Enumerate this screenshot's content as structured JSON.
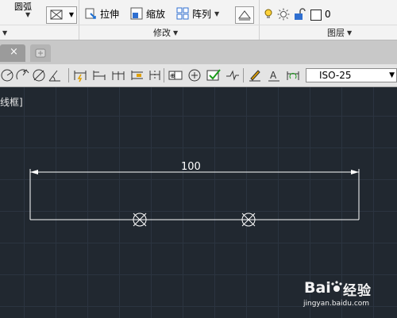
{
  "ribbon": {
    "arc_label": "圆弧",
    "stretch_label": "拉伸",
    "scale_label": "缩放",
    "array_label": "阵列",
    "modify_panel": "修改",
    "layers_panel": "图层",
    "layer_value": "0"
  },
  "dim_toolbar": {
    "dim_style": "ISO-25"
  },
  "drawing": {
    "viewport_label": "线框]",
    "dimension_text": "100"
  },
  "watermark": {
    "brand_cn": "经验",
    "url": "jingyan.baidu.com"
  },
  "colors": {
    "canvas_bg": "#212830",
    "grid": "#2b3440",
    "geometry": "#ffffff",
    "ribbon_bg": "#f3f3f3"
  }
}
